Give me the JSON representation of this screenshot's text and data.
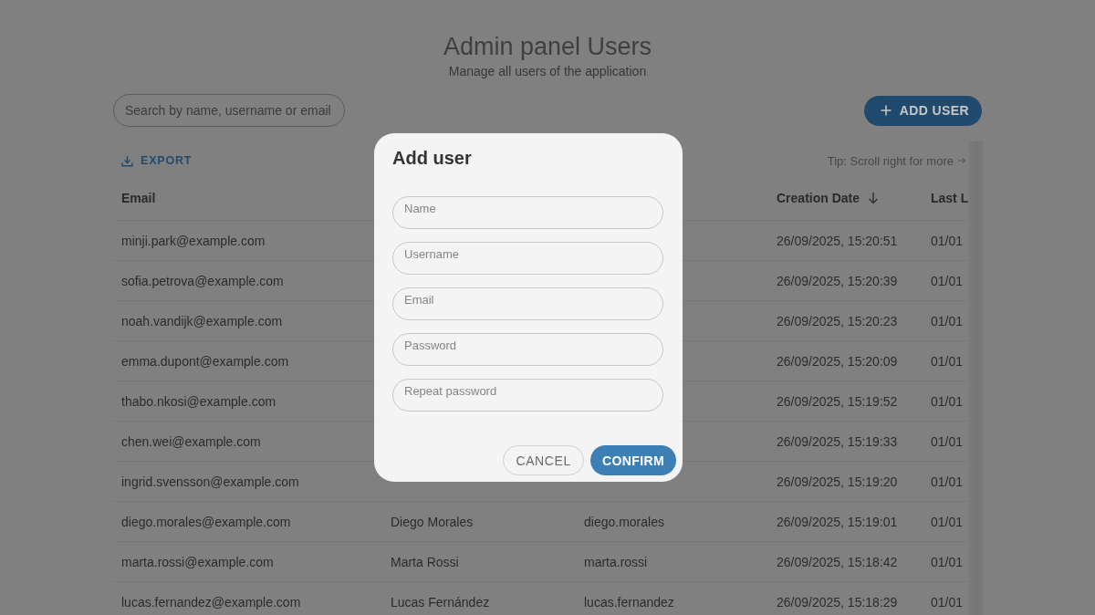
{
  "header": {
    "title": "Admin panel Users",
    "subtitle": "Manage all users of the application"
  },
  "search": {
    "placeholder": "Search by name, username or email"
  },
  "add_button": {
    "label": "ADD USER"
  },
  "export_button": {
    "label": "EXPORT"
  },
  "tip": "Tip: Scroll right for more",
  "table": {
    "columns": {
      "email": {
        "label": "Email",
        "sorted": false
      },
      "creation_date": {
        "label": "Creation Date",
        "sorted": true
      },
      "column_5": {
        "label": "Last L",
        "sorted": false
      }
    },
    "rows": [
      {
        "email": "minji.park@example.com",
        "creation_date": "26/09/2025, 15:20:51",
        "column_5": "01/01"
      },
      {
        "email": "sofia.petrova@example.com",
        "creation_date": "26/09/2025, 15:20:39",
        "column_5": "01/01"
      },
      {
        "email": "noah.vandijk@example.com",
        "creation_date": "26/09/2025, 15:20:23",
        "column_5": "01/01"
      },
      {
        "email": "emma.dupont@example.com",
        "creation_date": "26/09/2025, 15:20:09",
        "column_5": "01/01"
      },
      {
        "email": "thabo.nkosi@example.com",
        "creation_date": "26/09/2025, 15:19:52",
        "column_5": "01/01"
      },
      {
        "email": "chen.wei@example.com",
        "creation_date": "26/09/2025, 15:19:33",
        "column_5": "01/01"
      },
      {
        "email": "ingrid.svensson@example.com",
        "creation_date": "26/09/2025, 15:19:20",
        "column_5": "01/01"
      },
      {
        "email": "diego.morales@example.com",
        "column_2": "Diego Morales",
        "column_3": "diego.morales",
        "creation_date": "26/09/2025, 15:19:01",
        "column_5": "01/01"
      },
      {
        "email": "marta.rossi@example.com",
        "column_2": "Marta Rossi",
        "column_3": "marta.rossi",
        "creation_date": "26/09/2025, 15:18:42",
        "column_5": "01/01"
      },
      {
        "email": "lucas.fernandez@example.com",
        "column_2": "Lucas Fernández",
        "column_3": "lucas.fernandez",
        "creation_date": "26/09/2025, 15:18:29",
        "column_5": "01/01"
      }
    ]
  },
  "dialog": {
    "title": "Add user",
    "fields": [
      {
        "placeholder": "Name"
      },
      {
        "placeholder": "Username"
      },
      {
        "placeholder": "Email"
      },
      {
        "placeholder": "Password"
      },
      {
        "placeholder": "Repeat password"
      }
    ],
    "buttons": [
      {
        "label": "CANCEL",
        "kind": "outlined"
      },
      {
        "label": "CONFIRM",
        "kind": "filled"
      }
    ]
  }
}
